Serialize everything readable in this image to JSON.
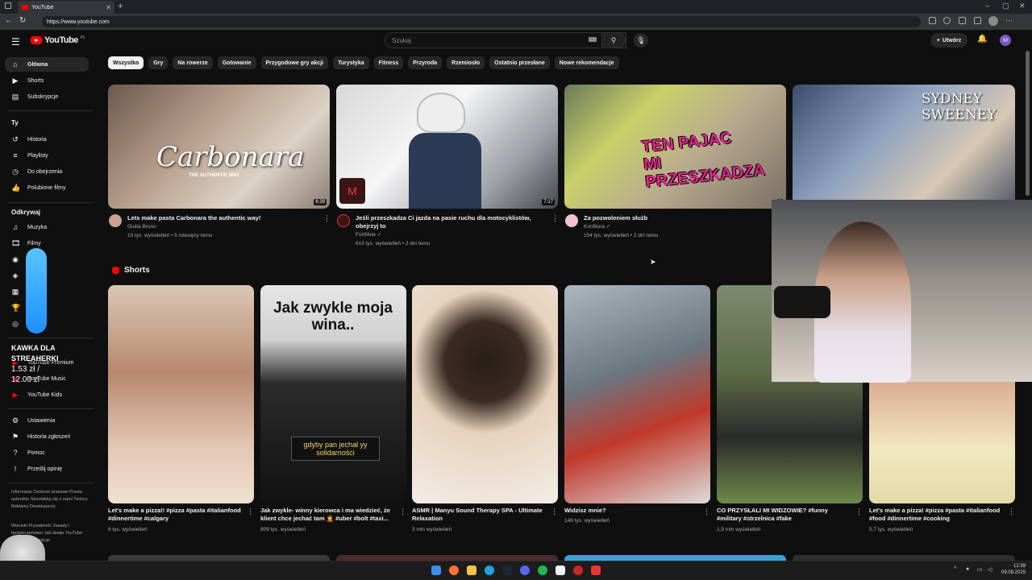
{
  "browser": {
    "tab_title": "YouTube",
    "url": "https://www.youtube.com"
  },
  "header": {
    "logo": "YouTube",
    "logo_region": "PL",
    "search_placeholder": "Szukaj",
    "create_label": "Utwórz",
    "avatar_letter": "M"
  },
  "sidebar": {
    "main": [
      {
        "label": "Główna",
        "icon": "home-icon"
      },
      {
        "label": "Shorts",
        "icon": "shorts-icon"
      },
      {
        "label": "Subskrypcje",
        "icon": "subscriptions-icon"
      }
    ],
    "you_header": "Ty",
    "you": [
      {
        "label": "Historia",
        "icon": "history-icon"
      },
      {
        "label": "Playlisty",
        "icon": "playlist-icon"
      },
      {
        "label": "Do obejrzenia",
        "icon": "clock-icon"
      },
      {
        "label": "Polubione filmy",
        "icon": "thumb-up-icon"
      }
    ],
    "explore_header": "Odkrywaj",
    "explore": [
      {
        "label": "Muzyka",
        "icon": "music-icon"
      },
      {
        "label": "Filmy",
        "icon": "film-icon"
      },
      {
        "label": "",
        "icon": "live-icon"
      },
      {
        "label": "",
        "icon": "gaming-icon"
      },
      {
        "label": "",
        "icon": "news-icon"
      },
      {
        "label": "",
        "icon": "trophy-icon"
      },
      {
        "label": "",
        "icon": "podcast-icon"
      }
    ],
    "more": [
      {
        "label": "YouTube Premium",
        "icon": "yt-premium-icon"
      },
      {
        "label": "YouTube Music",
        "icon": "yt-music-icon"
      },
      {
        "label": "YouTube Kids",
        "icon": "yt-kids-icon"
      }
    ],
    "settings": [
      {
        "label": "Ustawienia",
        "icon": "gear-icon"
      },
      {
        "label": "Historia zgłoszeń",
        "icon": "flag-icon"
      },
      {
        "label": "Pomoc",
        "icon": "help-icon"
      },
      {
        "label": "Prześlij opinię",
        "icon": "feedback-icon"
      }
    ],
    "footer1": "Informacje  Centrum prasowe  Prawa autorskie  Skontaktuj się z nami  Twórcy  Reklamy  Deweloperzy",
    "footer2": "Warunki  Prywatność  Zasady i bezpieczeństwo  Jak działa YouTube  Testuj nowe funkcje"
  },
  "chips": [
    "Wszystko",
    "Gry",
    "Na rowerze",
    "Gotowanie",
    "Przygodowe gry akcji",
    "Turystyka",
    "Fitness",
    "Przyroda",
    "Rzemiosło",
    "Ostatnio przesłane",
    "Nowe rekomendacje"
  ],
  "videos": [
    {
      "title": "Lets make pasta Carbonara the authentic way!",
      "channel": "Giulia Bruno",
      "meta": "10 tys. wyświetleń • 5 miesięcy temu",
      "duration": "6:39",
      "overlay": "Carbonara",
      "overlay_sub": "THE AUTHENTIC WAY"
    },
    {
      "title": "Jeśli przeszkadza Ci jazda na pasie ruchu dla motocyklistów, obejrzyj to",
      "channel": "FortNine ✓",
      "meta": "615 tys. wyświetleń • 2 dni temu",
      "duration": "7:17"
    },
    {
      "title": "Za pozwoleniem służb",
      "channel": "Konfitura ✓",
      "meta": "154 tys. wyświetleń • 2 dni temu",
      "duration": "2",
      "overlay": "TEN PAJAC MI PRZESZKADZA"
    },
    {
      "title": "",
      "channel": "",
      "meta": "",
      "duration": "",
      "overlay": "SYDNEY SWEENEY"
    }
  ],
  "shorts_title": "Shorts",
  "shorts": [
    {
      "title": "Let's make a pizza!! #pizza #pasta #italianfood #dinnertime #calgary",
      "meta": "8 tys. wyświetleń",
      "overlay": ""
    },
    {
      "title": "Jak zwykle- winny kierowca i ma wiedzieć, że klient chce jechać tam 🤦 #uber #bolt #taxi...",
      "meta": "809 tys. wyświetleń",
      "overlay": "Jak zwykle moja wina..",
      "overlay2": "gdyby pan jechał yy solidarności"
    },
    {
      "title": "ASMR | Manyu Sound Therapy SPA - Ultimate Relaxation",
      "meta": "3 mln wyświetleń",
      "overlay": ""
    },
    {
      "title": "Widzisz mnie?",
      "meta": "148 tys. wyświetleń",
      "overlay": ""
    },
    {
      "title": "CO PRZYSŁALI MI WIDZOWIE? #funny #military #strzelnica #fake",
      "meta": "1,9 mln wyświetleń",
      "overlay": ""
    },
    {
      "title": "Let's make a pizza! #pizza #pasta #italianfood #food #dinnertime #cooking",
      "meta": "5,7 tys. wyświetleń",
      "overlay": ""
    }
  ],
  "stream_overlay": {
    "line1": "KAWKA DLA",
    "line2": "STREAHERKI",
    "price1": "1.53 zł /",
    "price2": "12.00 zł"
  },
  "clock": {
    "time": "12:39",
    "date": "09.09.2025"
  }
}
